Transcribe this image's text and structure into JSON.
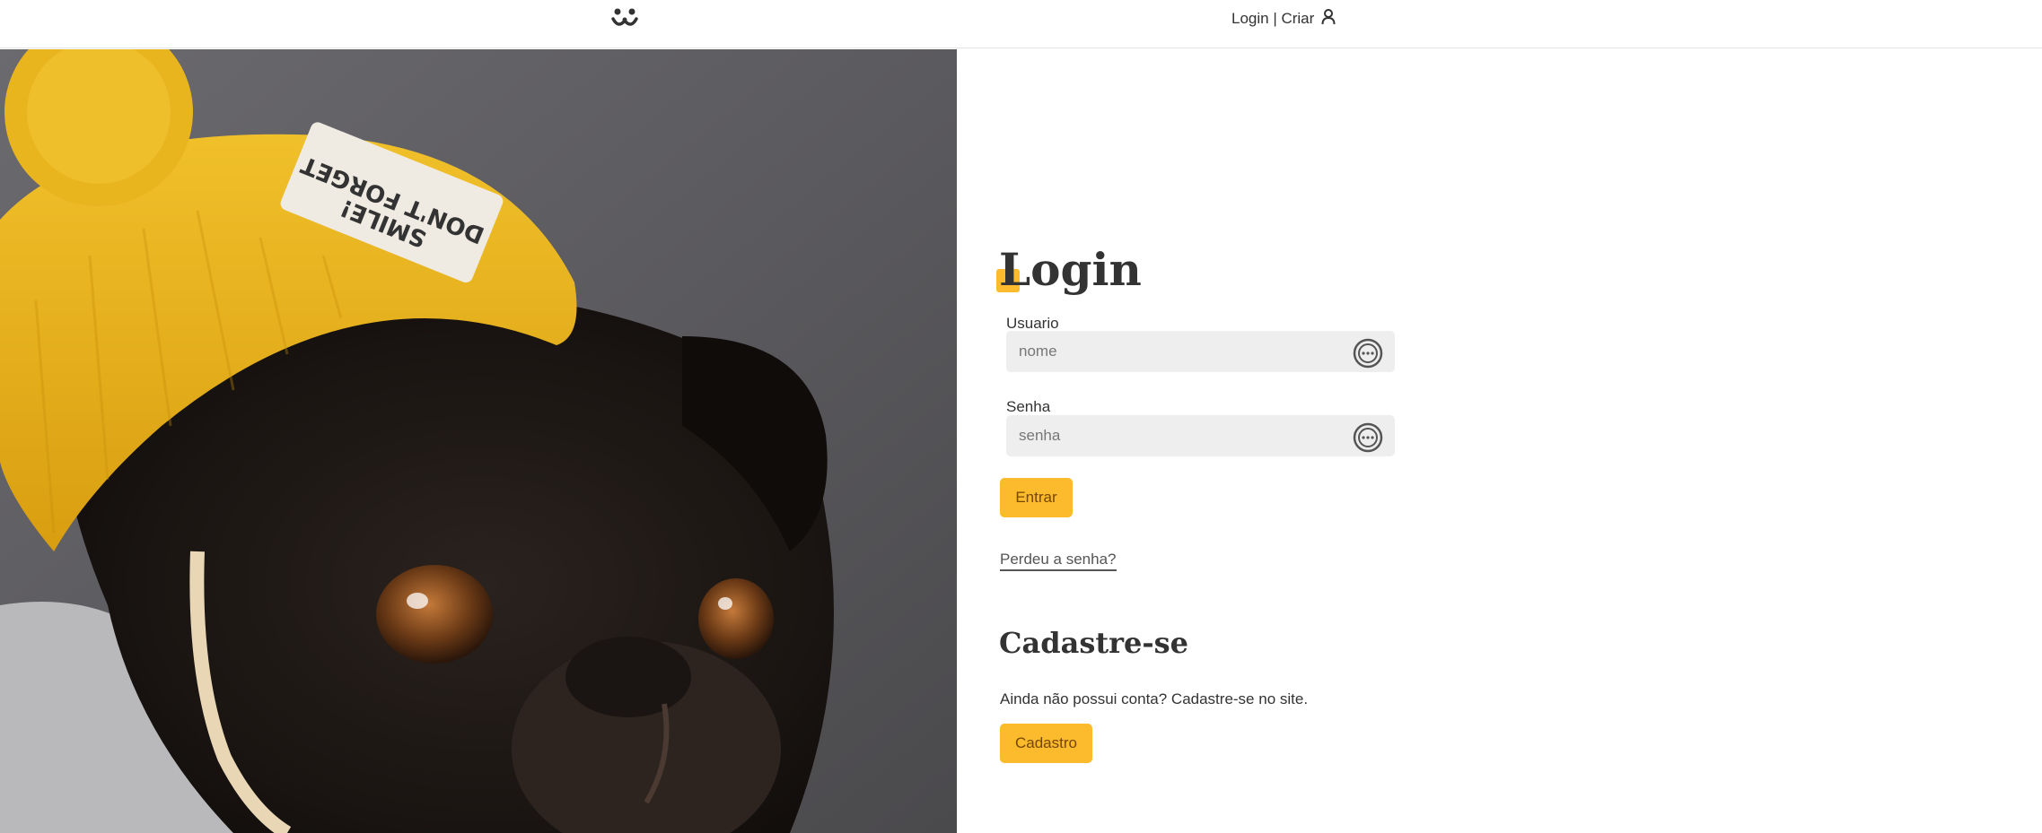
{
  "header": {
    "logo_icon": "dog-face-icon",
    "login_link_label": "Login | Criar",
    "user_icon": "user-icon"
  },
  "photo": {
    "subject": "pug-with-yellow-beanie",
    "hat_patch_text": "DON'T FORGET YOUR SMILE!"
  },
  "login": {
    "title": "Login",
    "username": {
      "label": "Usuario",
      "placeholder": "nome",
      "value": "",
      "icon": "password-manager-icon"
    },
    "password": {
      "label": "Senha",
      "placeholder": "senha",
      "value": "",
      "icon": "password-manager-icon"
    },
    "submit_label": "Entrar",
    "lost_password_label": "Perdeu a senha?"
  },
  "signup": {
    "title": "Cadastre-se",
    "text": "Ainda não possui conta? Cadastre-se no site.",
    "button_label": "Cadastro"
  },
  "colors": {
    "accent": "#fbbb2c",
    "button_text": "#764701",
    "text": "#333333",
    "input_bg": "#eeeeee"
  }
}
